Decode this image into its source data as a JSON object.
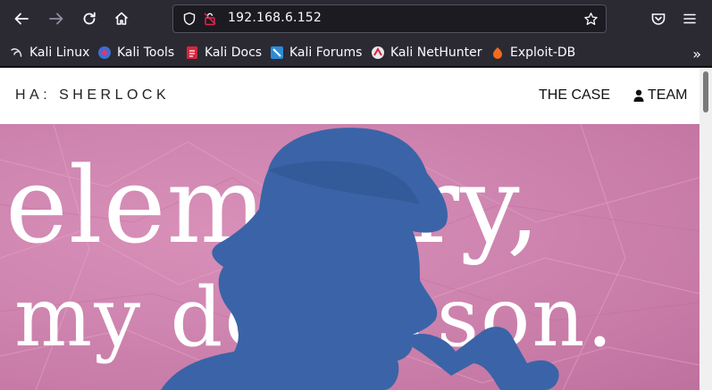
{
  "browser": {
    "url": "192.168.6.152",
    "bookmarks": [
      {
        "label": "Kali Linux",
        "icon": "kali-dragon-icon"
      },
      {
        "label": "Kali Tools",
        "icon": "kali-tools-icon"
      },
      {
        "label": "Kali Docs",
        "icon": "kali-docs-icon"
      },
      {
        "label": "Kali Forums",
        "icon": "kali-forums-icon"
      },
      {
        "label": "Kali NetHunter",
        "icon": "kali-nethunter-icon"
      },
      {
        "label": "Exploit-DB",
        "icon": "exploit-db-icon"
      }
    ]
  },
  "site": {
    "brand": "HA: SHERLOCK",
    "nav": {
      "case": "THE CASE",
      "team": "TEAM"
    },
    "hero": {
      "line1": "elem    tary,",
      "line2": "my de     vatson."
    }
  },
  "colors": {
    "chrome_bg": "#2b2a33",
    "hero_pink": "#cf86b0",
    "silhouette_blue": "#3a64a7"
  }
}
